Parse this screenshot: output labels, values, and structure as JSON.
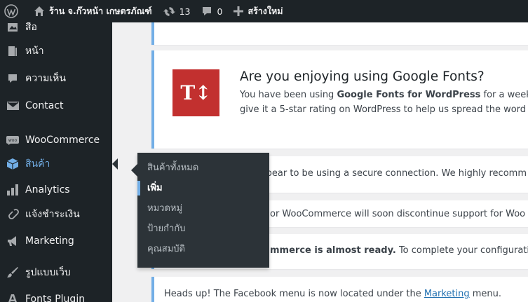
{
  "adminbar": {
    "site_name": "ร้าน จ.ก๊วหน้า เกษตรภัณฑ์",
    "updates_count": "13",
    "comments_count": "0",
    "new_label": "สร้างใหม่"
  },
  "sidebar": {
    "items": [
      {
        "label": "สื่อ",
        "icon": "media-icon"
      },
      {
        "label": "หน้า",
        "icon": "page-icon"
      },
      {
        "label": "ความเห็น",
        "icon": "comment-icon"
      },
      {
        "label": "Contact",
        "icon": "envelope-icon"
      },
      {
        "label": "WooCommerce",
        "icon": "woocommerce-icon"
      },
      {
        "label": "สินค้า",
        "icon": "product-box-icon"
      },
      {
        "label": "Analytics",
        "icon": "bar-chart-icon"
      },
      {
        "label": "แจ้งชำระเงิน",
        "icon": "link-icon"
      },
      {
        "label": "Marketing",
        "icon": "megaphone-icon"
      },
      {
        "label": "รูปแบบเว็บ",
        "icon": "paintbrush-icon"
      },
      {
        "label": "Fonts Plugin",
        "icon": "fonts-icon"
      }
    ]
  },
  "flyout": {
    "items": [
      {
        "label": "สินค้าทั้งหมด"
      },
      {
        "label": "เพิ่ม"
      },
      {
        "label": "หมวดหมู่"
      },
      {
        "label": "ป้ายกำกับ"
      },
      {
        "label": "คุณสมบัติ"
      }
    ]
  },
  "notices": {
    "gfonts": {
      "logo": "T↕",
      "title": "Are you enjoying using Google Fonts?",
      "line1_a": "You have been using ",
      "line1_b": "Google Fonts for WordPress",
      "line1_c": " for a week n",
      "line2": "give it a 5-star rating on WordPress to help us spread the word"
    },
    "ssl": "Your store does not appear to be using a secure connection. We highly recomm",
    "woo": "or WooCommerce will soon discontinue support for Woo",
    "ready_a": "mmerce is almost ready.",
    "ready_b": " To complete your configuration",
    "fb_a": "Heads up! The Facebook menu is now located under the ",
    "fb_link": "Marketing",
    "fb_b": " menu."
  },
  "colors": {
    "adminbar_bg": "#1d2327",
    "sidebar_bg": "#1d2327",
    "flyout_bg": "#2c3338",
    "accent": "#72aee6",
    "gfonts_logo": "#c2302f"
  }
}
